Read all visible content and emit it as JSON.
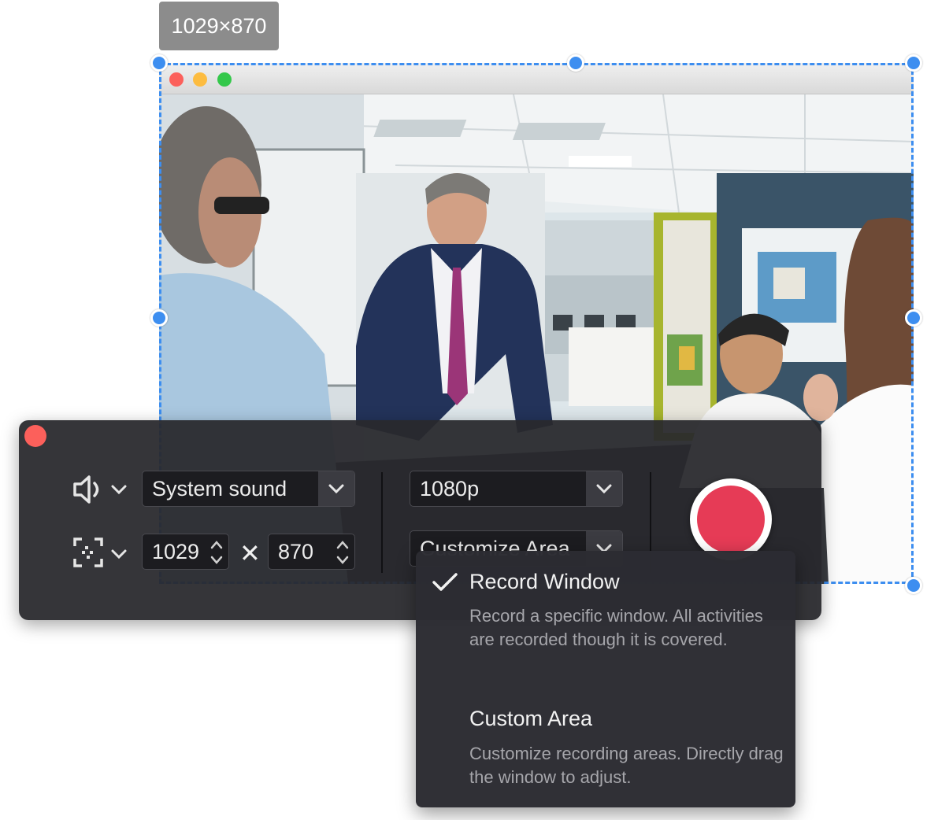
{
  "selection": {
    "size_label": "1029×870"
  },
  "target_window": {
    "photo_description_icon": "office-meeting-photo"
  },
  "toolbar": {
    "audio": {
      "icon": "speaker-icon",
      "selected": "System sound"
    },
    "area": {
      "icon": "region-select-icon",
      "width": "1029",
      "height": "870",
      "times_symbol": "✕"
    },
    "quality": {
      "selected": "1080p"
    },
    "mode": {
      "selected": "Customize Area"
    },
    "colors": {
      "record": "#e63b56",
      "close": "#fc605b",
      "accent": "#3d8ef0"
    }
  },
  "menu": {
    "items": [
      {
        "title": "Record Window",
        "checked": true,
        "description": "Record a specific window. All activities are recorded though it is covered."
      },
      {
        "title": "Custom Area",
        "checked": false,
        "description": "Customize recording areas. Directly drag the window to adjust."
      }
    ]
  }
}
